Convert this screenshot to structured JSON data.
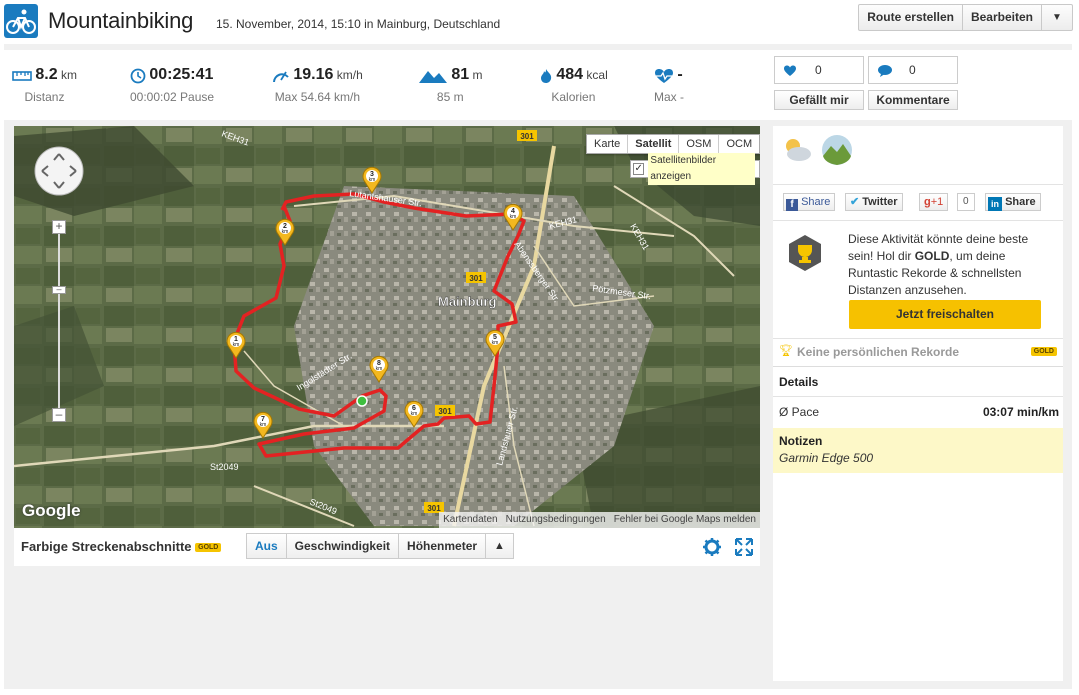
{
  "header": {
    "title": "Mountainbiking",
    "subtitle": "15. November, 2014, 15:10 in Mainburg, Deutschland",
    "buttons": {
      "create_route": "Route erstellen",
      "edit": "Bearbeiten",
      "dropdown": "▼"
    }
  },
  "stats": {
    "distance": {
      "value": "8.2",
      "unit": "km",
      "sub": "Distanz"
    },
    "duration": {
      "value": "00:25:41",
      "sub": "00:00:02 Pause"
    },
    "speed": {
      "value": "19.16",
      "unit": "km/h",
      "sub": "Max 54.64 km/h"
    },
    "elevation": {
      "value": "81",
      "unit": "m",
      "sub": "85 m"
    },
    "calories": {
      "value": "484",
      "unit": "kcal",
      "sub": "Kalorien"
    },
    "heart": {
      "value": "-",
      "sub": "Max -"
    }
  },
  "social": {
    "likes": "0",
    "comments": "0",
    "like_label": "Gefällt mir",
    "comment_label": "Kommentare"
  },
  "map": {
    "type_buttons": [
      "Karte",
      "Satellit",
      "OSM",
      "OCM"
    ],
    "satellite_checkbox": "Satellitenbilder anzeigen",
    "labels": {
      "town": "Mainburg",
      "street1": "Lutantshauser Str.",
      "street2": "Ingolstädter Str.",
      "street3": "Abenssberger Str.",
      "street4": "Pötzmeser Str.",
      "street5": "Landshuter Str.",
      "r301a": "301",
      "r301b": "301",
      "r301c": "301",
      "r301d": "301",
      "keh31a": "KEH31",
      "keh31b": "KEH31",
      "keh31c": "KEH31",
      "st2049a": "St2049",
      "st2049b": "St2049"
    },
    "footer": [
      "Kartendaten",
      "Nutzungsbedingungen",
      "Fehler bei Google Maps melden"
    ],
    "google": "Google",
    "km_unit": "km",
    "markers": [
      "1",
      "2",
      "3",
      "4",
      "5",
      "6",
      "7",
      "8"
    ]
  },
  "segments": {
    "label": "Farbige Streckenabschnitte",
    "gold": "GOLD",
    "buttons": [
      "Aus",
      "Geschwindigkeit",
      "Höhenmeter",
      "▲"
    ]
  },
  "sidebar": {
    "share": {
      "facebook": "Share",
      "twitter": "Twitter",
      "gplus": "+1",
      "gplus_count": "0",
      "linkedin": "Share",
      "g_letter": "g"
    },
    "promo": {
      "line1": "Diese Aktivität könnte deine beste",
      "line2a": "sein! Hol dir ",
      "line2b": "GOLD",
      "line2c": ", um deine",
      "line3": "Runtastic Rekorde & schnellsten",
      "line4": "Distanzen anzusehen.",
      "button": "Jetzt freischalten"
    },
    "records": {
      "label": "Keine persönlichen Rekorde",
      "gold": "GOLD"
    },
    "details": {
      "title": "Details",
      "pace_label": "Ø Pace",
      "pace_value": "03:07 min/km"
    },
    "notes": {
      "title": "Notizen",
      "text": "Garmin Edge 500"
    }
  },
  "colors": {
    "accent": "#1a7bbf",
    "route": "#e02020",
    "gold": "#f5c400",
    "notes_bg": "#fdf8c8"
  }
}
